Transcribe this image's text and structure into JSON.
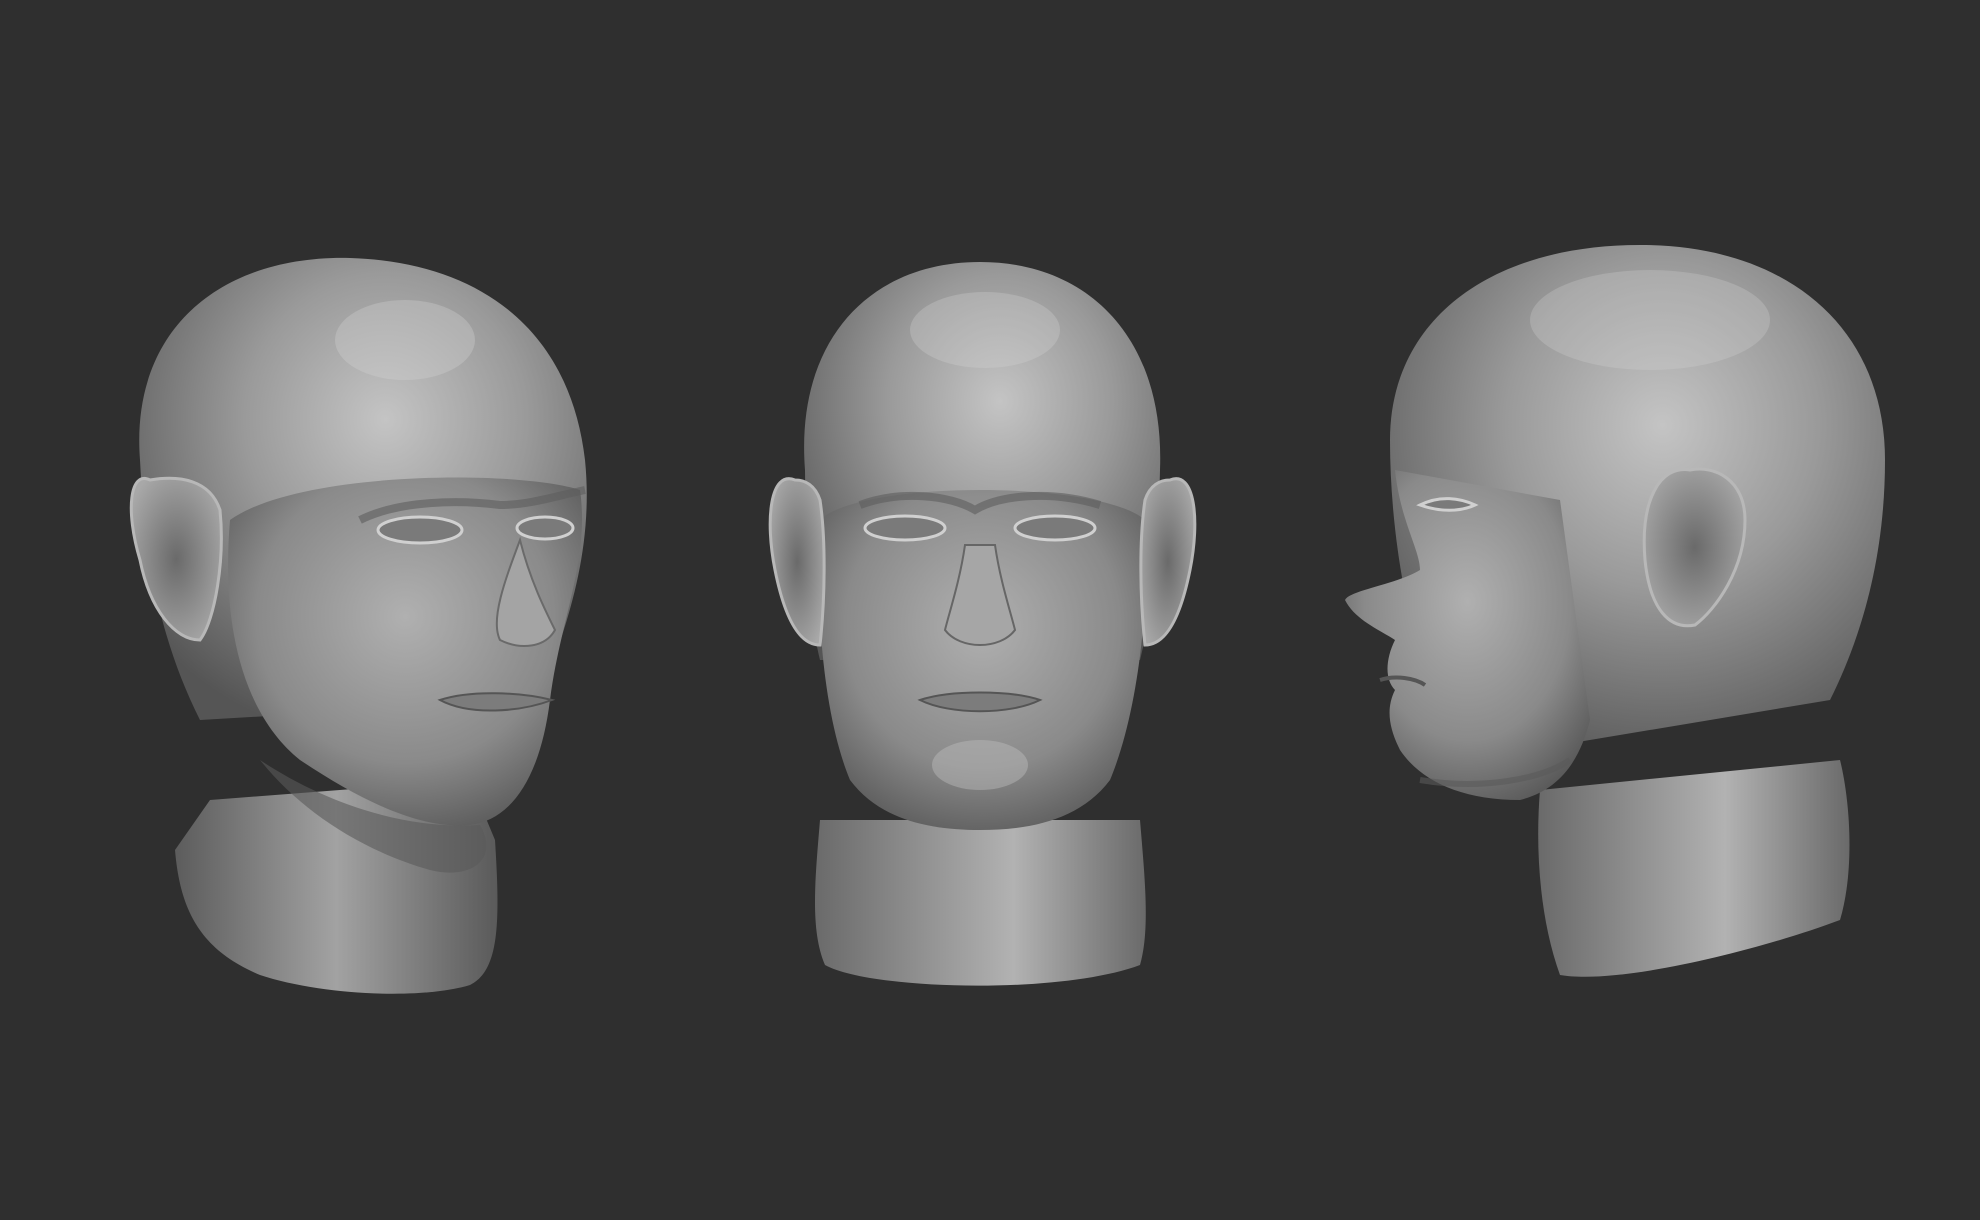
{
  "scene": {
    "background_color": "#2f2f2f",
    "clay_color": "#8c8c8c",
    "clay_highlight": "#bdbdbd",
    "clay_shadow": "#4a4a4a",
    "views": [
      {
        "name": "three-quarter-view",
        "description_icon": "head-sculpt-3q"
      },
      {
        "name": "front-view",
        "description_icon": "head-sculpt-front"
      },
      {
        "name": "profile-view",
        "description_icon": "head-sculpt-profile"
      }
    ]
  }
}
